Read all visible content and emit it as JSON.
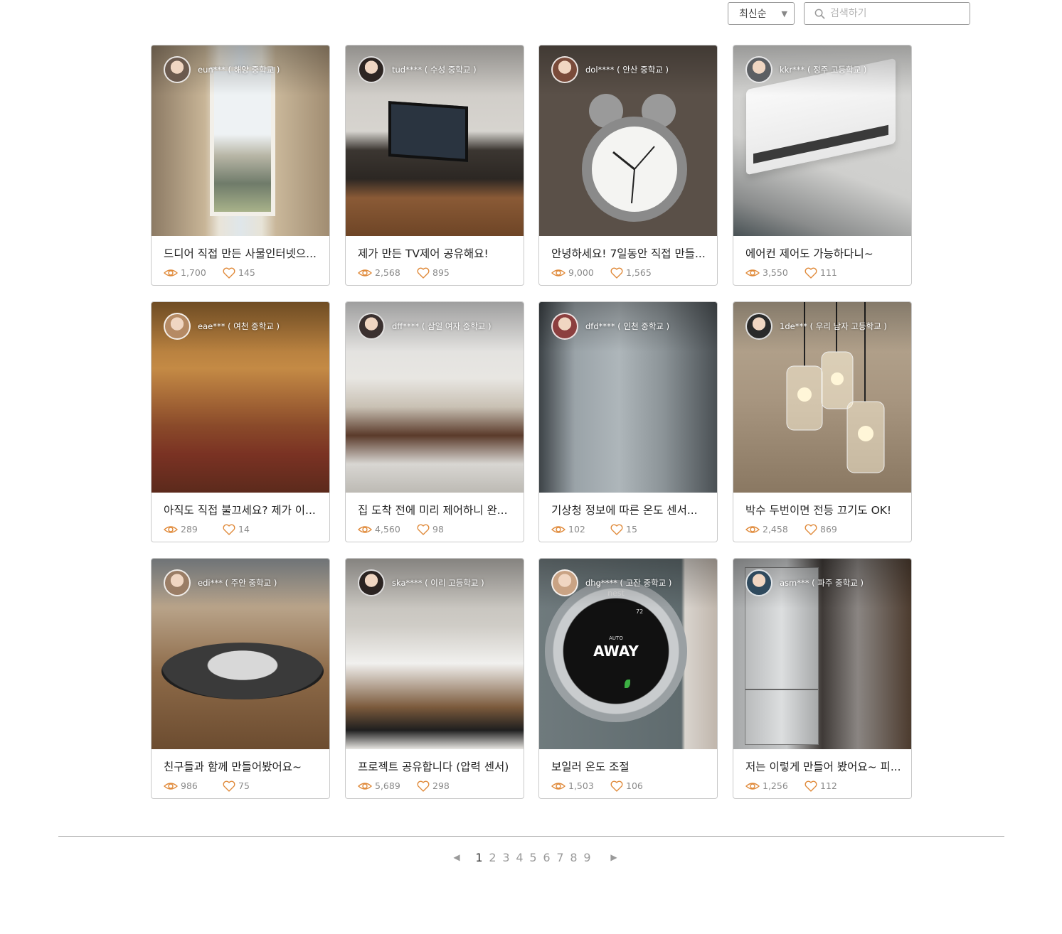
{
  "toolbar": {
    "sort": {
      "selected": "최신순"
    },
    "search": {
      "placeholder": "검색하기",
      "value": ""
    }
  },
  "posts": [
    {
      "author": "eun*** ( 해양 중학교 )",
      "title": "드디어 직접 만든 사물인터넷으...",
      "views": "1,700",
      "likes": "145",
      "scene": "window"
    },
    {
      "author": "tud**** ( 수성 중학교 )",
      "title": "제가 만든 TV제어 공유해요!",
      "views": "2,568",
      "likes": "895",
      "scene": "tv"
    },
    {
      "author": "dol**** ( 안산 중학교 )",
      "title": "안녕하세요! 7일동안 직접 만들...",
      "views": "9,000",
      "likes": "1,565",
      "scene": "clock"
    },
    {
      "author": "kkr*** ( 정주 고등학교 )",
      "title": "에어컨 제어도 가능하다니~",
      "views": "3,550",
      "likes": "111",
      "scene": "aircon"
    },
    {
      "author": "eae*** ( 여천 중학교 )",
      "title": "아직도 직접 불끄세요? 제가 이...",
      "views": "289",
      "likes": "14",
      "scene": "bedroom"
    },
    {
      "author": "dff**** ( 삼일 여자 중학교 )",
      "title": "집 도착 전에 미리 제어하니 완...",
      "views": "4,560",
      "likes": "98",
      "scene": "living"
    },
    {
      "author": "dfd**** ( 인천 중학교 )",
      "title": "기상청 정보에 따른 온도 센서...",
      "views": "102",
      "likes": "15",
      "scene": "rain"
    },
    {
      "author": "1de*** ( 우리 남자 고등학교 )",
      "title": "박수 두번이면 전등 끄기도 OK!",
      "views": "2,458",
      "likes": "869",
      "scene": "lamps"
    },
    {
      "author": "edi*** ( 주안 중학교 )",
      "title": "친구들과 함께 만들어봤어요~",
      "views": "986",
      "likes": "75",
      "scene": "robot"
    },
    {
      "author": "ska**** ( 이리 고등학교 )",
      "title": "프로젝트 공유합니다 (압력 센서)",
      "views": "5,689",
      "likes": "298",
      "scene": "bed"
    },
    {
      "author": "dhg**** ( 고잔 중학교 )",
      "title": "보일러 온도 조절",
      "views": "1,503",
      "likes": "106",
      "scene": "thermostat",
      "thermostat_brand": "nest",
      "thermostat_mode": "AUTO",
      "thermostat_state": "AWAY",
      "thermostat_temp": "72"
    },
    {
      "author": "asm*** ( 파주 중학교 )",
      "title": "저는 이렇게 만들어 봤어요~ 피...",
      "views": "1,256",
      "likes": "112",
      "scene": "kitchen"
    }
  ],
  "pagination": {
    "pages": [
      "1",
      "2",
      "3",
      "4",
      "5",
      "6",
      "7",
      "8",
      "9"
    ],
    "current": "1",
    "prev_icon": "triangle-left-icon",
    "next_icon": "triangle-right-icon"
  },
  "colors": {
    "accent": "#e08a3a",
    "border": "#c9c9c9",
    "muted_text": "#8a8a8a"
  }
}
